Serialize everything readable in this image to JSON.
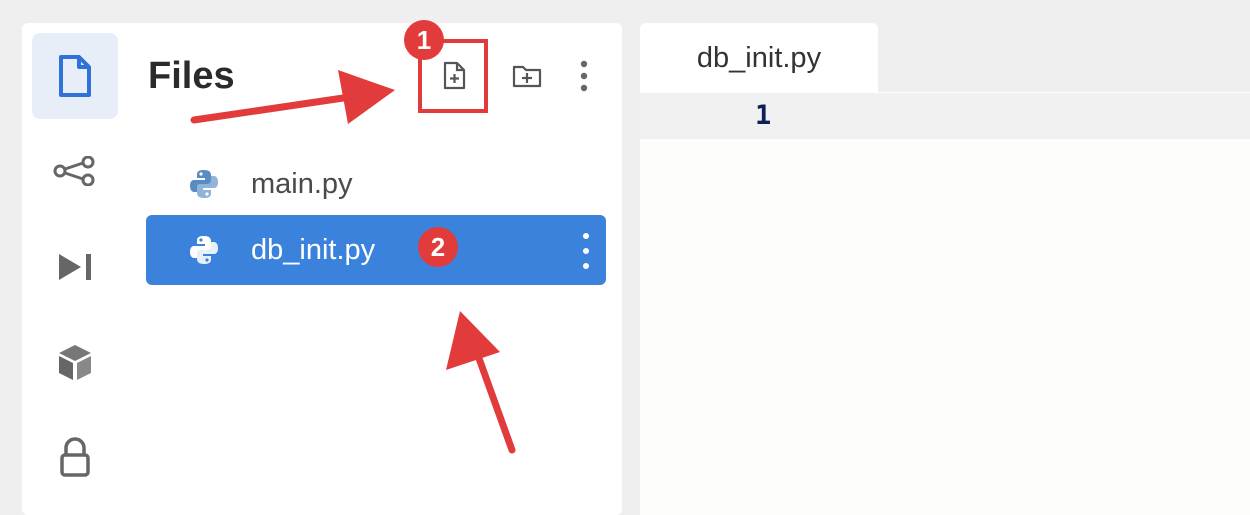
{
  "sidebar": {
    "title": "Files",
    "activity_icons": [
      "file-icon",
      "share-icon",
      "play-step-icon",
      "package-icon",
      "lock-icon"
    ],
    "header_actions": [
      "new-file-icon",
      "new-folder-icon",
      "more-vertical-icon"
    ]
  },
  "files": [
    {
      "name": "main.py",
      "selected": false
    },
    {
      "name": "db_init.py",
      "selected": true
    }
  ],
  "editor": {
    "tab_label": "db_init.py",
    "line_number": "1"
  },
  "annotations": {
    "badge_1": "1",
    "badge_2": "2",
    "color": "#e23b3b"
  },
  "colors": {
    "accent": "#3b82dc",
    "python_blue": "#4b7fb8"
  }
}
